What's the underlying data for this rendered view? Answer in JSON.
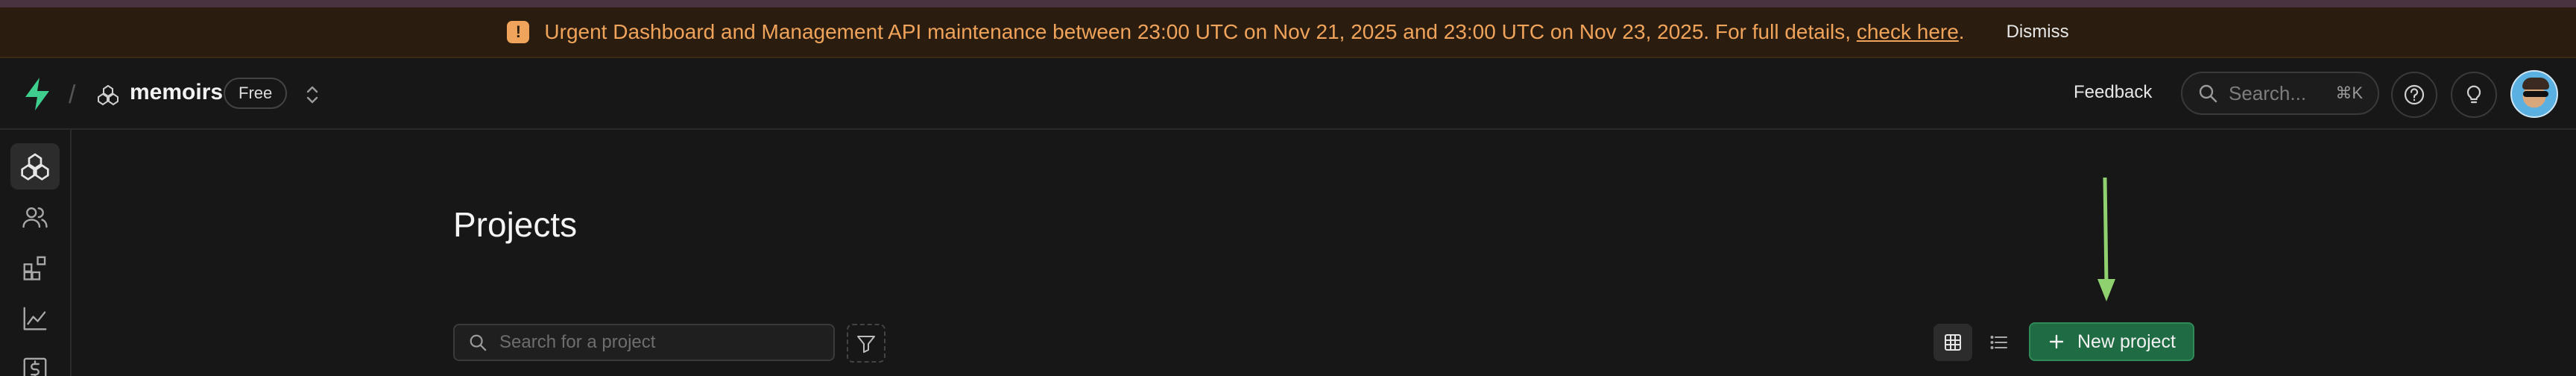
{
  "banner": {
    "message": "Urgent Dashboard and Management API maintenance between 23:00 UTC on Nov 21, 2025 and 23:00 UTC on Nov 23, 2025. For full details,",
    "link_text": "check here",
    "trailing": ".",
    "dismiss_label": "Dismiss"
  },
  "header": {
    "org_name": "memoirs",
    "plan_badge": "Free",
    "feedback_label": "Feedback",
    "search_placeholder": "Search...",
    "search_shortcut": "⌘K"
  },
  "sidebar": {
    "items": [
      {
        "icon": "projects-icon",
        "active": true
      },
      {
        "icon": "team-icon",
        "active": false
      },
      {
        "icon": "integrations-icon",
        "active": false
      },
      {
        "icon": "usage-icon",
        "active": false
      },
      {
        "icon": "billing-icon",
        "active": false
      }
    ]
  },
  "main": {
    "title": "Projects",
    "search_placeholder": "Search for a project",
    "new_project_label": "New project"
  },
  "colors": {
    "background": "#171717",
    "banner_bg": "#2a1d0f",
    "banner_text": "#f0a35a",
    "brand_green": "#3ecf8e",
    "primary_button": "#1f6b43",
    "annotation_arrow": "#8fd06f"
  }
}
